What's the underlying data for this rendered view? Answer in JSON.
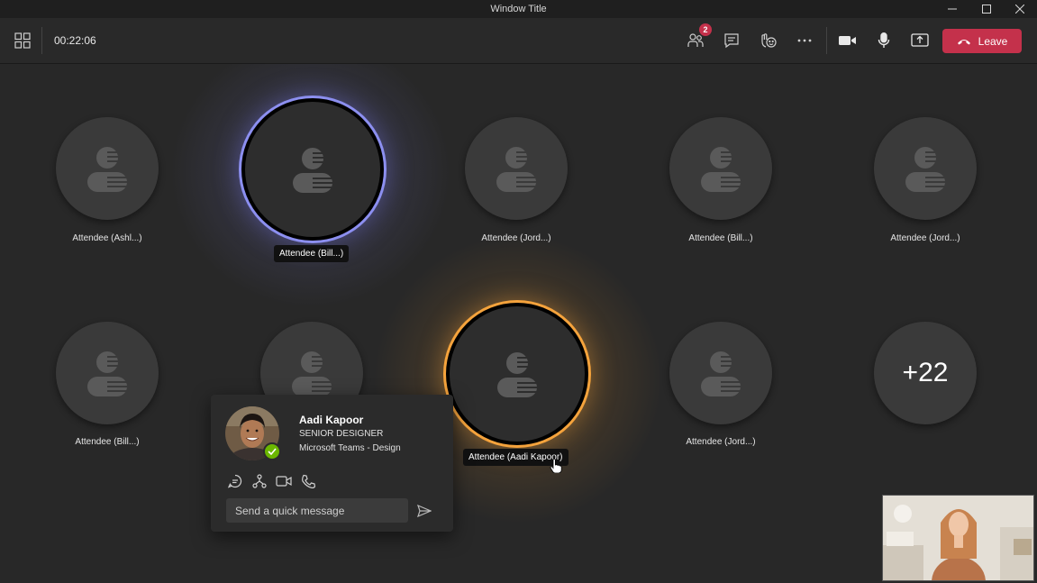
{
  "window": {
    "title": "Window Title",
    "minimize_icon": "minimize-icon",
    "maximize_icon": "maximize-icon",
    "close_icon": "close-icon"
  },
  "toolbar": {
    "timer": "00:22:06",
    "participants_badge": "2",
    "leave_label": "Leave",
    "leave_color": "#c4314b",
    "icons": [
      "grid-layout-icon",
      "participants-icon",
      "chat-icon",
      "reactions-icon",
      "more-icon",
      "camera-icon",
      "microphone-icon",
      "share-screen-icon",
      "hang-up-icon"
    ]
  },
  "attendees": [
    {
      "name": "Attendee (Ashl...)",
      "state": "idle"
    },
    {
      "name": "Attendee (Bill...)",
      "state": "speaking",
      "ring_color": "#8c8ff0"
    },
    {
      "name": "Attendee (Jord...)",
      "state": "idle"
    },
    {
      "name": "Attendee (Bill...)",
      "state": "idle"
    },
    {
      "name": "Attendee (Jord...)",
      "state": "idle"
    },
    {
      "name": "Attendee (Bill...)",
      "state": "idle"
    },
    {
      "name": "",
      "state": "idle"
    },
    {
      "name": "Attendee (Aadi Kapoor)",
      "state": "speaking",
      "ring_color": "#f5a33c"
    },
    {
      "name": "Attendee (Jord...)",
      "state": "idle"
    }
  ],
  "overflow": {
    "label": "+22"
  },
  "profile_card": {
    "name": "Aadi Kapoor",
    "title": "SENIOR DESIGNER",
    "department": "Microsoft Teams - Design",
    "presence": "available",
    "presence_color": "#6bb700",
    "actions": [
      "chat-icon",
      "org-chart-icon",
      "video-call-icon",
      "audio-call-icon"
    ],
    "message_placeholder": "Send a quick message",
    "send_icon": "send-icon"
  },
  "self_view": {
    "description_icon": "self-video"
  }
}
